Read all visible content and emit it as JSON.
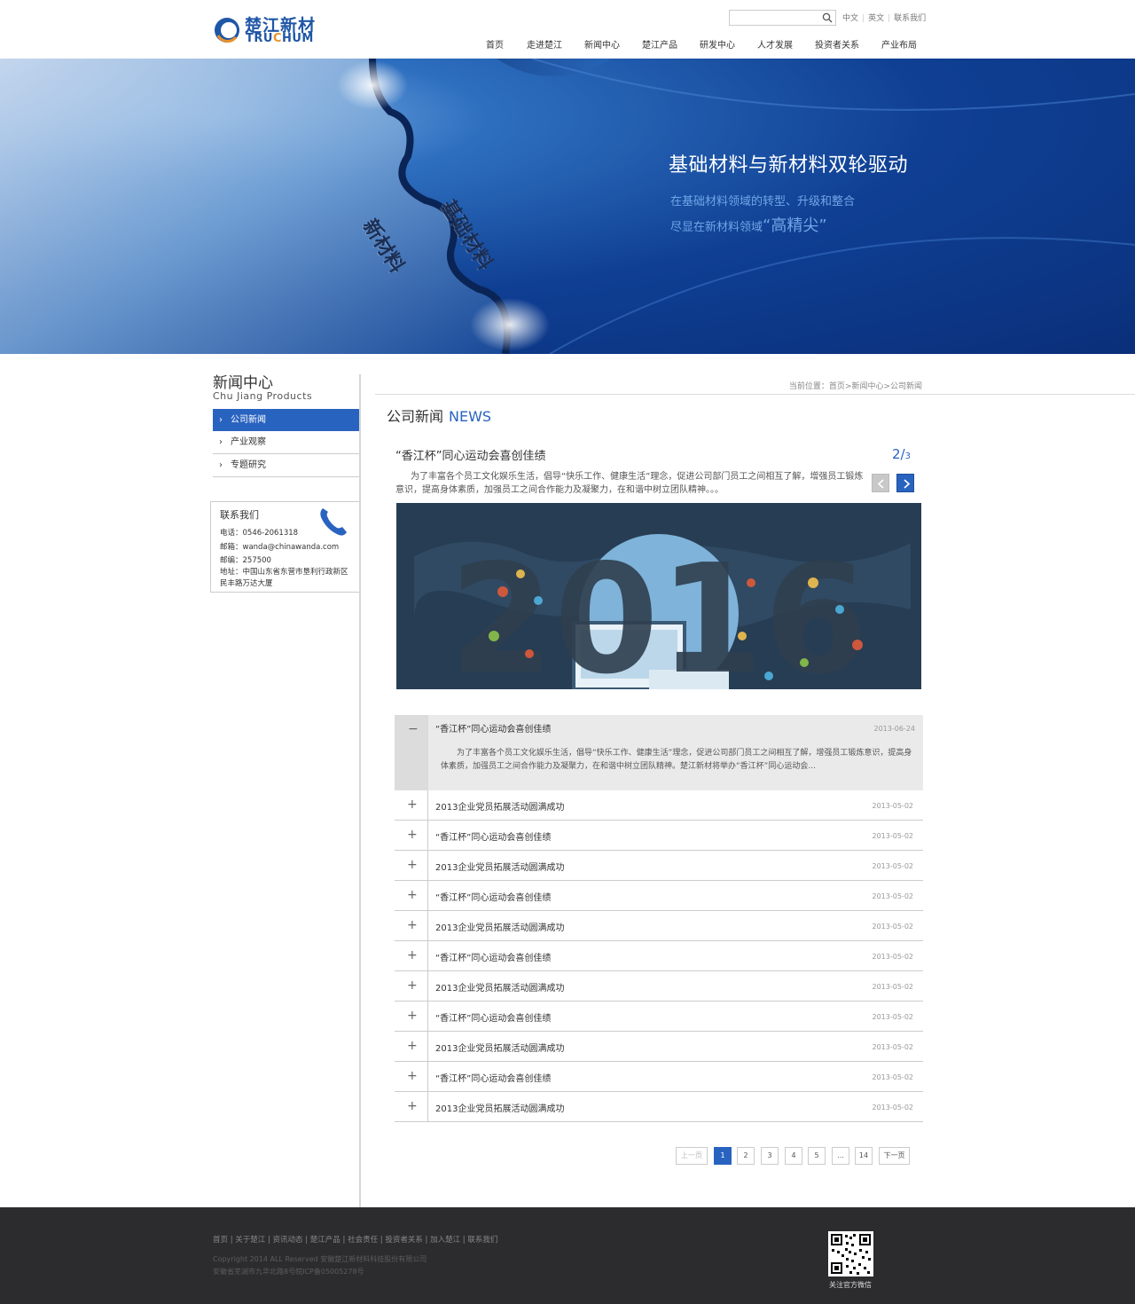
{
  "brand": {
    "name_cn": "楚江新材",
    "name_en_pre": "TRU",
    "name_en_o": "C",
    "name_en_post": "HUM"
  },
  "search": {
    "placeholder": ""
  },
  "top_links": [
    "中文",
    "英文",
    "联系我们"
  ],
  "nav": [
    "首页",
    "走进楚江",
    "新闻中心",
    "楚江产品",
    "研发中心",
    "人才发展",
    "投资者关系",
    "产业布局"
  ],
  "banner": {
    "title": "基础材料与新材料双轮驱动",
    "sub1": "在基础材料领域的转型、升级和整合",
    "sub2_pre": "尽显在新材料领域",
    "sub2_big": "“高精尖”",
    "gear_label_1": "基础材料",
    "gear_label_2": "新材料"
  },
  "sidebar": {
    "title": "新闻中心",
    "subtitle": "Chu Jiang Products",
    "items": [
      {
        "label": "公司新闻",
        "active": true
      },
      {
        "label": "产业观察",
        "active": false
      },
      {
        "label": "专题研究",
        "active": false
      }
    ],
    "contact": {
      "title": "联系我们",
      "phone": "电话：0546-2061318",
      "email": "邮箱：wanda@chinawanda.com",
      "postcode": "邮编：257500",
      "address_1": "地址：中国山东省东营市垦利行政新区",
      "address_2": "民丰路万达大厦"
    }
  },
  "breadcrumb": "当前位置：首页>新闻中心>公司新闻",
  "section": {
    "title": "公司新闻",
    "title_en": "NEWS"
  },
  "featured": {
    "title": "“香江杯”同心运动会喜创佳绩",
    "page_current": "2/",
    "page_total": "3",
    "desc": "为了丰富各个员工文化娱乐生活，倡导“快乐工作、健康生活”理念，促进公司部门员工之间相互了解，增强员工锻炼意识，提高身体素质，加强员工之间合作能力及凝聚力，在和谐中树立团队精神。。。",
    "image_text": "2016"
  },
  "news_open": {
    "title": "“香江杯”同心运动会喜创佳绩",
    "date": "2013-06-24",
    "desc": "为了丰富各个员工文化娱乐生活，倡导“快乐工作、健康生活”理念，促进公司部门员工之间相互了解，增强员工锻炼意识，提高身体素质，加强员工之间合作能力及凝聚力，在和谐中树立团队精神。楚江新材将举办“香江杯”同心运动会..."
  },
  "news": [
    {
      "title": "2013企业党员拓展活动圆满成功",
      "date": "2013-05-02"
    },
    {
      "title": "“香江杯”同心运动会喜创佳绩",
      "date": "2013-05-02"
    },
    {
      "title": "2013企业党员拓展活动圆满成功",
      "date": "2013-05-02"
    },
    {
      "title": "“香江杯”同心运动会喜创佳绩",
      "date": "2013-05-02"
    },
    {
      "title": "2013企业党员拓展活动圆满成功",
      "date": "2013-05-02"
    },
    {
      "title": "“香江杯”同心运动会喜创佳绩",
      "date": "2013-05-02"
    },
    {
      "title": "2013企业党员拓展活动圆满成功",
      "date": "2013-05-02"
    },
    {
      "title": "“香江杯”同心运动会喜创佳绩",
      "date": "2013-05-02"
    },
    {
      "title": "2013企业党员拓展活动圆满成功",
      "date": "2013-05-02"
    },
    {
      "title": "“香江杯”同心运动会喜创佳绩",
      "date": "2013-05-02"
    },
    {
      "title": "2013企业党员拓展活动圆满成功",
      "date": "2013-05-02"
    }
  ],
  "pager": {
    "prev": "上一页",
    "pages": [
      "1",
      "2",
      "3",
      "4",
      "5",
      "...",
      "14"
    ],
    "active": "1",
    "next": "下一页"
  },
  "footer": {
    "nav": "首页 | 关于楚江 | 资讯动态 | 楚江产品 | 社会责任 | 投资者关系 | 加入楚江 | 联系我们",
    "copyright": "Copyright   2014 ALL Reserved 安徽楚江新材料科技股份有限公司",
    "address": "安徽省芜湖市九华北路8号皖ICP备05005278号",
    "qr_label": "关注官方微信"
  },
  "colors": {
    "accent": "#2963c0",
    "footer_bg": "#2c2c2e",
    "banner_dark": "#0a2f7a"
  }
}
